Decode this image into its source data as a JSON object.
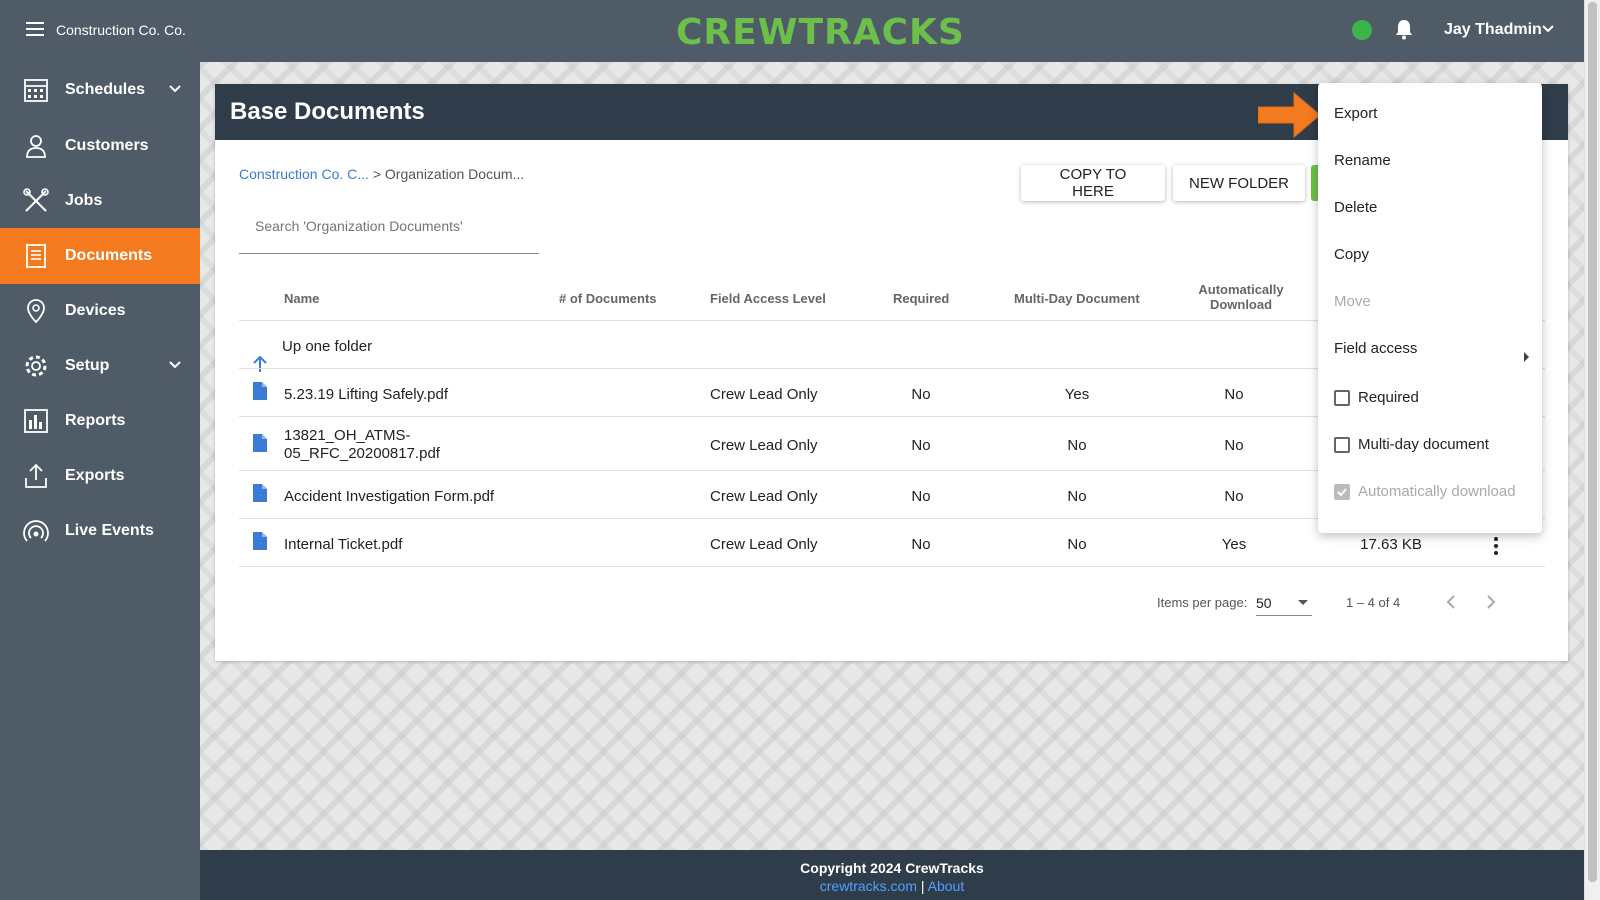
{
  "topbar": {
    "org_name": "Construction Co. Co.",
    "logo": "CREWTRACKS",
    "user_name": "Jay Thadmin",
    "status_color": "#3ab54a"
  },
  "sidebar": {
    "items": [
      {
        "label": "Schedules",
        "icon": "calendar-icon",
        "has_chevron": true
      },
      {
        "label": "Customers",
        "icon": "customer-icon",
        "has_chevron": false
      },
      {
        "label": "Jobs",
        "icon": "tools-icon",
        "has_chevron": false
      },
      {
        "label": "Documents",
        "icon": "documents-icon",
        "has_chevron": false,
        "active": true
      },
      {
        "label": "Devices",
        "icon": "location-pin-icon",
        "has_chevron": false
      },
      {
        "label": "Setup",
        "icon": "gear-icon",
        "has_chevron": true
      },
      {
        "label": "Reports",
        "icon": "bar-chart-icon",
        "has_chevron": false
      },
      {
        "label": "Exports",
        "icon": "upload-icon",
        "has_chevron": false
      },
      {
        "label": "Live Events",
        "icon": "broadcast-icon",
        "has_chevron": false
      }
    ],
    "accent_color": "#f47a20"
  },
  "page": {
    "title": "Base Documents",
    "breadcrumb_link": "Construction Co. C...",
    "breadcrumb_sep": " > ",
    "breadcrumb_current": "Organization Docum...",
    "search_placeholder": "Search 'Organization Documents'",
    "buttons": {
      "copy_to_here": "COPY TO HERE",
      "new_folder": "NEW FOLDER"
    }
  },
  "table": {
    "headers": {
      "name": "Name",
      "num_docs": "# of Documents",
      "field_access": "Field Access Level",
      "required": "Required",
      "multi_day": "Multi-Day Document",
      "auto_download_1": "Automatically",
      "auto_download_2": "Download"
    },
    "up_folder": "Up one folder",
    "rows": [
      {
        "name": "5.23.19 Lifting Safely.pdf",
        "field_access": "Crew Lead Only",
        "required": "No",
        "multi_day": "Yes",
        "auto_download": "No",
        "size": ""
      },
      {
        "name_1": "13821_OH_ATMS-",
        "name_2": "05_RFC_20200817.pdf",
        "field_access": "Crew Lead Only",
        "required": "No",
        "multi_day": "No",
        "auto_download": "No",
        "size": ""
      },
      {
        "name": "Accident Investigation Form.pdf",
        "field_access": "Crew Lead Only",
        "required": "No",
        "multi_day": "No",
        "auto_download": "No",
        "size": ""
      },
      {
        "name": "Internal Ticket.pdf",
        "field_access": "Crew Lead Only",
        "required": "No",
        "multi_day": "No",
        "auto_download": "Yes",
        "size": "17.63 KB"
      }
    ]
  },
  "pager": {
    "items_label": "Items per page:",
    "items_value": "50",
    "range": "1 – 4 of 4"
  },
  "menu": {
    "export": "Export",
    "rename": "Rename",
    "delete": "Delete",
    "copy": "Copy",
    "move": "Move",
    "field_access": "Field access",
    "required": "Required",
    "multi_day": "Multi-day document",
    "auto_download": "Automatically download"
  },
  "footer": {
    "copyright": "Copyright 2024 CrewTracks",
    "link_site": "crewtracks.com",
    "separator": " | ",
    "link_about": "About"
  }
}
